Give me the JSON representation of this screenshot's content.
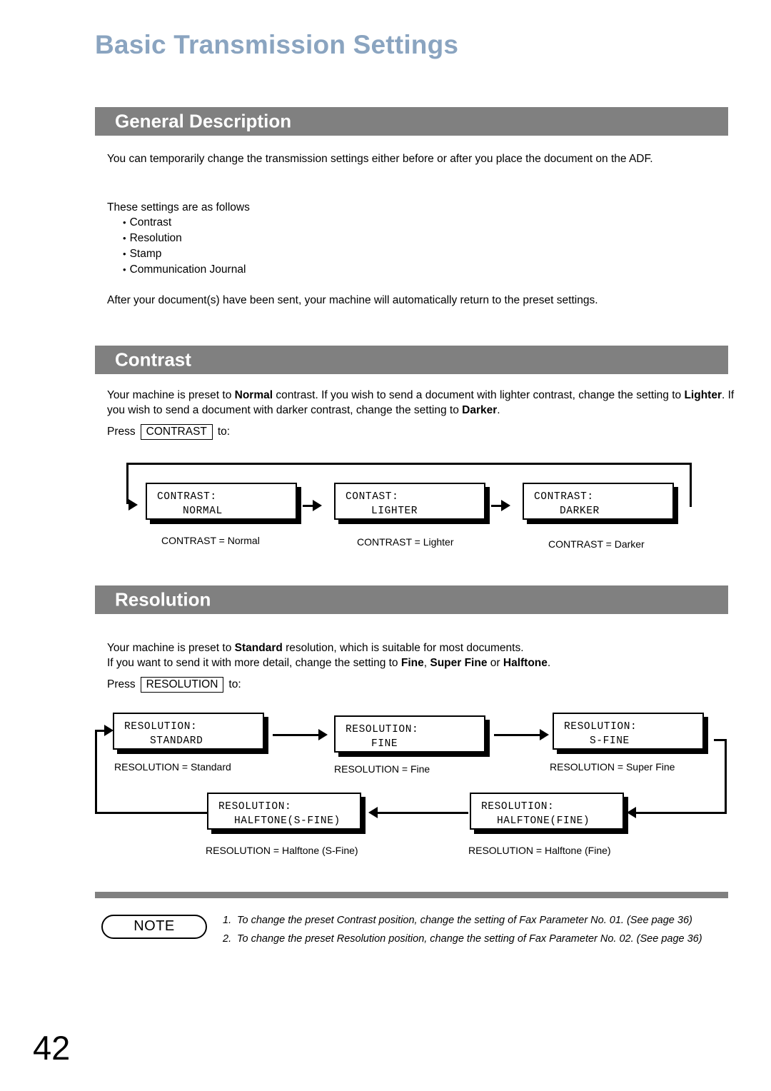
{
  "page": {
    "title": "Basic Transmission Settings",
    "number": "42",
    "title_color": "#8aa4c0",
    "bar_color": "#808080"
  },
  "sections": {
    "general": {
      "heading": "General Description",
      "p1": "You can temporarily change the transmission settings either before or after you place the document on the ADF.",
      "p2": "These settings are as follows",
      "bullets": [
        "Contrast",
        "Resolution",
        "Stamp",
        "Communication Journal"
      ],
      "p3": "After your document(s) have been sent, your machine will automatically return to the preset settings."
    },
    "contrast": {
      "heading": "Contrast",
      "p1_a": "Your machine is preset to ",
      "p1_b": "Normal",
      "p1_c": " contrast.  If you wish to send a document with lighter contrast, change the setting to ",
      "p1_d": "Lighter",
      "p1_e": ".  If you wish to send a document with darker contrast, change the setting to ",
      "p1_f": "Darker",
      "p1_g": ".",
      "press_prefix": "Press",
      "press_key": "CONTRAST",
      "press_suffix": "to:",
      "steps": [
        {
          "lcd_line1": "CONTRAST:",
          "lcd_line2": "NORMAL",
          "caption": "CONTRAST = Normal"
        },
        {
          "lcd_line1": "CONTAST:",
          "lcd_line2": "LIGHTER",
          "caption": "CONTRAST = Lighter"
        },
        {
          "lcd_line1": "CONTRAST:",
          "lcd_line2": "DARKER",
          "caption": "CONTRAST = Darker"
        }
      ]
    },
    "resolution": {
      "heading": "Resolution",
      "p1_a": "Your machine is preset to ",
      "p1_b": "Standard",
      "p1_c": " resolution, which is suitable for most documents.",
      "p2_a": "If you want to send it with more detail, change the setting to ",
      "p2_b": "Fine",
      "p2_c": ", ",
      "p2_d": "Super Fine",
      "p2_e": " or ",
      "p2_f": "Halftone",
      "p2_g": ".",
      "press_prefix": "Press",
      "press_key": "RESOLUTION",
      "press_suffix": "to:",
      "steps": [
        {
          "lcd_line1": "RESOLUTION:",
          "lcd_line2": "STANDARD",
          "caption": "RESOLUTION = Standard"
        },
        {
          "lcd_line1": "RESOLUTION:",
          "lcd_line2": "FINE",
          "caption": "RESOLUTION = Fine"
        },
        {
          "lcd_line1": "RESOLUTION:",
          "lcd_line2": "S-FINE",
          "caption": "RESOLUTION = Super Fine"
        },
        {
          "lcd_line1": "RESOLUTION:",
          "lcd_line2": "HALFTONE(FINE)",
          "caption": "RESOLUTION = Halftone (Fine)"
        },
        {
          "lcd_line1": "RESOLUTION:",
          "lcd_line2": "HALFTONE(S-FINE)",
          "caption": "RESOLUTION = Halftone (S-Fine)"
        }
      ]
    }
  },
  "note": {
    "label": "NOTE",
    "items": [
      {
        "num": "1.",
        "text": "To change the preset Contrast position, change the setting of Fax Parameter No. 01. (See page 36)"
      },
      {
        "num": "2.",
        "text": "To change the preset Resolution position, change the setting of Fax Parameter No. 02.  (See page 36)"
      }
    ]
  }
}
